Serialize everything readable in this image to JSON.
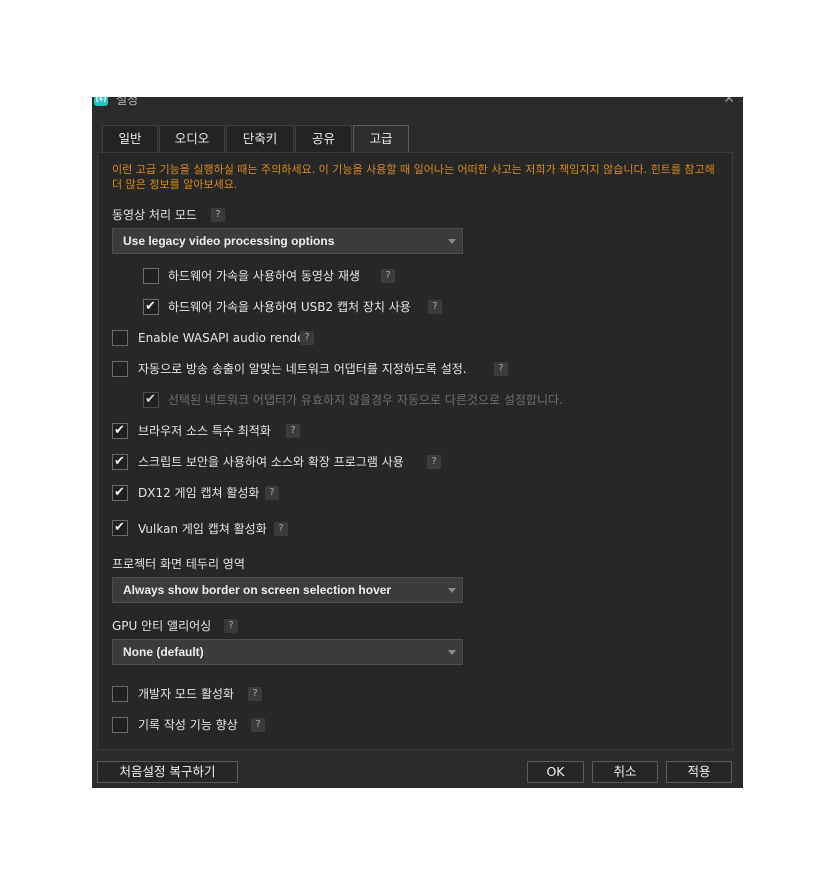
{
  "window": {
    "title": "설정",
    "close_label": "✕",
    "app_icon": "broadcast-icon"
  },
  "tabs": [
    {
      "label": "일반",
      "active": false
    },
    {
      "label": "오디오",
      "active": false
    },
    {
      "label": "단축키",
      "active": false
    },
    {
      "label": "공유",
      "active": false
    },
    {
      "label": "고급",
      "active": true
    }
  ],
  "warning": "이런 고급 기능을 실행하실 때는 주의하세요. 이 기능을 사용할 때 일어나는 어떠한 사고는 저희가 책임지지 않습니다. 힌트를 참고해 더 많은 정보를 알아보세요.",
  "help_glyph": "?",
  "video_mode": {
    "label": "동영상 처리 모드",
    "selected": "Use legacy video processing options"
  },
  "options": {
    "hw_playback": {
      "label": "하드웨어 가속을 사용하여 동영상 재생",
      "checked": false
    },
    "hw_usb2": {
      "label": "하드웨어 가속을 사용하여 USB2 캡처 장치 사용",
      "checked": true
    },
    "wasapi": {
      "label": "Enable WASAPI audio render",
      "checked": false
    },
    "auto_adapter": {
      "label": "자동으로 방송 송출이 알맞는 네트워크 어댑터를 지정하도록 설정.",
      "checked": false
    },
    "adapter_fallback": {
      "label": "선택된 네트워크 어댑터가 유효하지 않을경우 자동으로 다른것으로 설정합니다.",
      "checked": true,
      "disabled": true
    },
    "browser_opt": {
      "label": "브라우저 소스 특수 최적화",
      "checked": true
    },
    "script_security": {
      "label": "스크립트 보안을 사용하여 소스와 확장 프로그램 사용",
      "checked": true
    },
    "dx12": {
      "label": "DX12 게임 캡쳐 활성화",
      "checked": true
    },
    "vulkan": {
      "label": "Vulkan 게임 캡쳐 활성화",
      "checked": true
    },
    "dev_mode": {
      "label": "개발자 모드 활성화",
      "checked": false
    },
    "logging": {
      "label": "기록 작성 기능 향상",
      "checked": false
    }
  },
  "projector_border": {
    "label": "프로젝터 화면 테두리 영역",
    "selected": "Always show border on screen selection hover"
  },
  "gpu_aa": {
    "label": "GPU 안티 앨리어싱",
    "selected": "None (default)"
  },
  "buttons": {
    "reset": "처음설정 복구하기",
    "ok": "OK",
    "cancel": "취소",
    "apply": "적용"
  },
  "check_glyph": "✔"
}
